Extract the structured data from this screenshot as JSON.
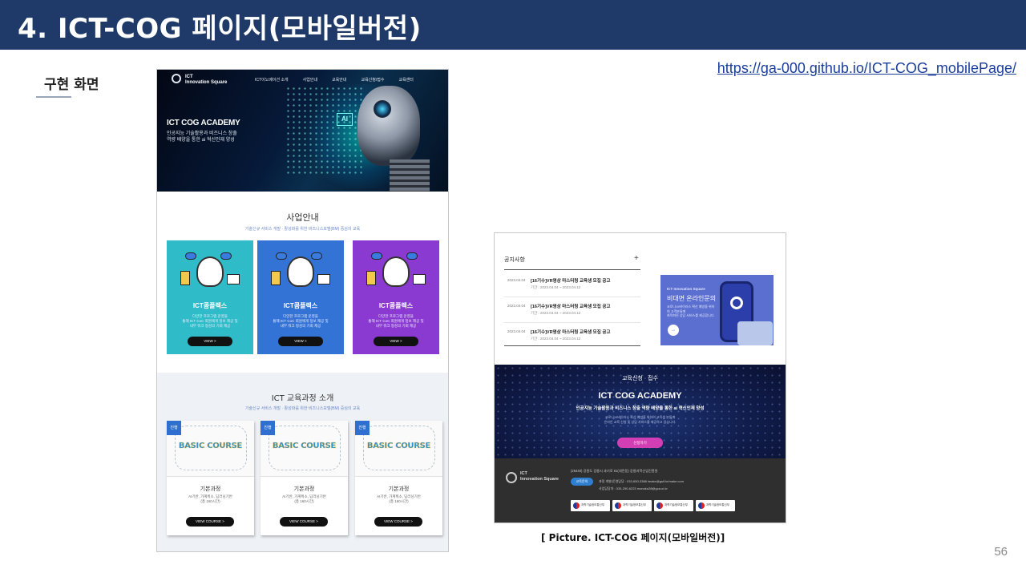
{
  "slide": {
    "title": "4. ICT-COG 페이지(모바일버전)",
    "section_label": "구현 화면",
    "url": "https://ga-000.github.io/ICT-COG_mobilePage/",
    "caption": "[ Picture. ICT-COG 페이지(모바일버전)]",
    "page_number": "56"
  },
  "colors": {
    "header_bg": "#1f3a68",
    "card_teal": "#2fbcc8",
    "card_blue": "#3373d6",
    "card_purple": "#8a3ad0",
    "apply_button": "#d23fb5"
  },
  "left_screen": {
    "brand": "ICT\nInnovation Square",
    "nav": [
      "ICT이노베이션 소개",
      "사업안내",
      "교육안내",
      "교육신청/접수",
      "교육센터"
    ],
    "hero_title": "ICT COG ACADEMY",
    "hero_sub": "인공지능 기술활용과 비즈니스 창출\n역량 배양을 통한 ai 혁신인재 양성",
    "hero_chip": "AI",
    "biz_title": "사업안내",
    "biz_sub": "기술신규 서비스 개발 · 활성화를 위한 비즈니스모델(BM) 중심의 교육",
    "biz_cards": [
      {
        "title": "ICT콤플렉스",
        "desc": "다양한 프로그램 운영을\n통해 ICT CoC 회원에게 정보 제공 및\n내부 워크 형성의 기회 제공",
        "button": "VIEW >"
      },
      {
        "title": "ICT콤플렉스",
        "desc": "다양한 프로그램 운영을\n통해 ICT CoC 회원에게 정보 제공 및\n내부 워크 형성의 기회 제공",
        "button": "VIEW >"
      },
      {
        "title": "ICT콤플렉스",
        "desc": "다양한 프로그램 운영을\n통해 ICT CoC 회원에게 정보 제공 및\n내부 워크 형성의 기회 제공",
        "button": "VIEW >"
      }
    ],
    "course_title": "ICT 교육과정 소개",
    "course_sub": "기술신규 서비스 개발 · 활성화를 위한 비즈니스모델(BM) 중심의 교육",
    "course_cards": [
      {
        "badge": "진행",
        "image_text": "BASIC COURSE",
        "label": "기본과정",
        "desc": "AI기반, 가계획소, 딥러닝기반\n(총 160시간)",
        "button": "VIEW COURSE >"
      },
      {
        "badge": "진행",
        "image_text": "BASIC COURSE",
        "label": "기본과정",
        "desc": "AI기반, 가계획소, 딥러닝기반\n(총 160시간)",
        "button": "VIEW COURSE >"
      },
      {
        "badge": "진행",
        "image_text": "BASIC COURSE",
        "label": "기본과정",
        "desc": "AI기반, 가계획소, 딥러닝기반\n(총 160시간)",
        "button": "VIEW COURSE >"
      }
    ]
  },
  "right_screen": {
    "notice_heading": "공지사항",
    "notice_plus": "+",
    "notices": [
      {
        "date": "2023.04.04",
        "title": "[16기수]VR영상 마스터링 교육생 모집 공고",
        "period": "기간 : 2023.04.04 ~ 2023.04.12"
      },
      {
        "date": "2023.04.04",
        "title": "[16기수]VR영상 마스터링 교육생 모집 공고",
        "period": "기간 : 2023.04.04 ~ 2023.04.12"
      },
      {
        "date": "2023.04.04",
        "title": "[16기수]VR영상 마스터링 교육생 모집 공고",
        "period": "기간 : 2023.04.04 ~ 2023.04.12"
      }
    ],
    "consult": {
      "brand": "ICT Innovation Square",
      "title": "비대면 온라인문의",
      "desc": "코로나19바이러스 확산 예방을 위하여 고객분들께\n최적화된 상담 서비스를 제공합니다.",
      "button": "→"
    },
    "apply": {
      "heading": "교육신청 · 접수",
      "title": "ICT COG ACADEMY",
      "sub": "인공지능 기술활용과 비즈니스 창출 역량 배양을 통한 ai 혁신인재 양성",
      "desc": "코로나19바이러스 확산 예방을 위하여 교육생 분들께\n온라인 교육 신청 및 상담 서비스를 제공하고 있습니다.",
      "button": "신청하기"
    },
    "footer": {
      "brand": "ICT\nInnovation Square",
      "address": "(25440) 강원도 강릉시 과기로 61(대전동) 강릉과학산업진흥원",
      "pill": "교육문의",
      "contact": "과정 개발/운영담당 : 033-650-3388 imake@gsif.kr/make.com\n사업담당자 : 033-290-6223 monako28@gca.or.kr",
      "org_logos": [
        "과학기술정보통신부",
        "과학기술정보통신부",
        "과학기술정보통신부",
        "과학기술정보통신부"
      ]
    }
  }
}
